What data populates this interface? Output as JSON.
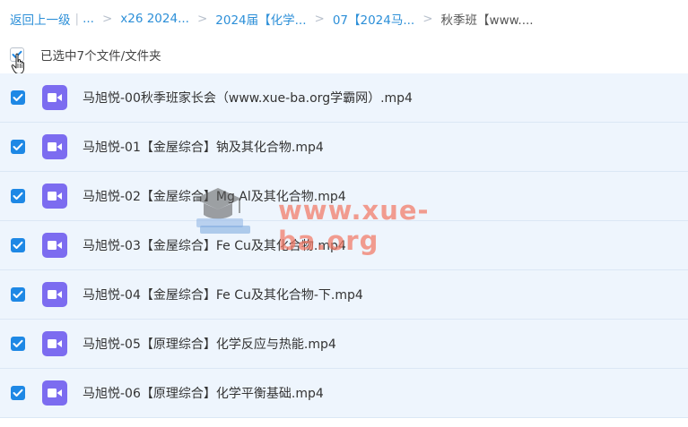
{
  "breadcrumb": {
    "back_label": "返回上一级",
    "ellipsis": "...",
    "items": [
      "x26 2024...",
      "2024届【化学...",
      "07【2024马...",
      "秋季班【www...."
    ],
    "separator": ">"
  },
  "selection": {
    "text": "已选中7个文件/文件夹"
  },
  "files": [
    {
      "name": "马旭悦-00秋季班家长会（www.xue-ba.org学霸网）.mp4",
      "checked": true
    },
    {
      "name": "马旭悦-01【金屋综合】钠及其化合物.mp4",
      "checked": true
    },
    {
      "name": "马旭悦-02【金屋综合】Mg Al及其化合物.mp4",
      "checked": true
    },
    {
      "name": "马旭悦-03【金屋综合】Fe Cu及其化合物.mp4",
      "checked": true
    },
    {
      "name": "马旭悦-04【金屋综合】Fe Cu及其化合物-下.mp4",
      "checked": true
    },
    {
      "name": "马旭悦-05【原理综合】化学反应与热能.mp4",
      "checked": true
    },
    {
      "name": "马旭悦-06【原理综合】化学平衡基础.mp4",
      "checked": true
    }
  ],
  "icons": {
    "file": "video-file-icon",
    "check": "checkmark-icon"
  },
  "colors": {
    "link": "#2c8fd8",
    "checkbox": "#1e88e5",
    "file_icon": "#7c6cf0",
    "row_selected": "#eef5fd"
  },
  "watermark": {
    "text": "www.xue-ba.org"
  }
}
